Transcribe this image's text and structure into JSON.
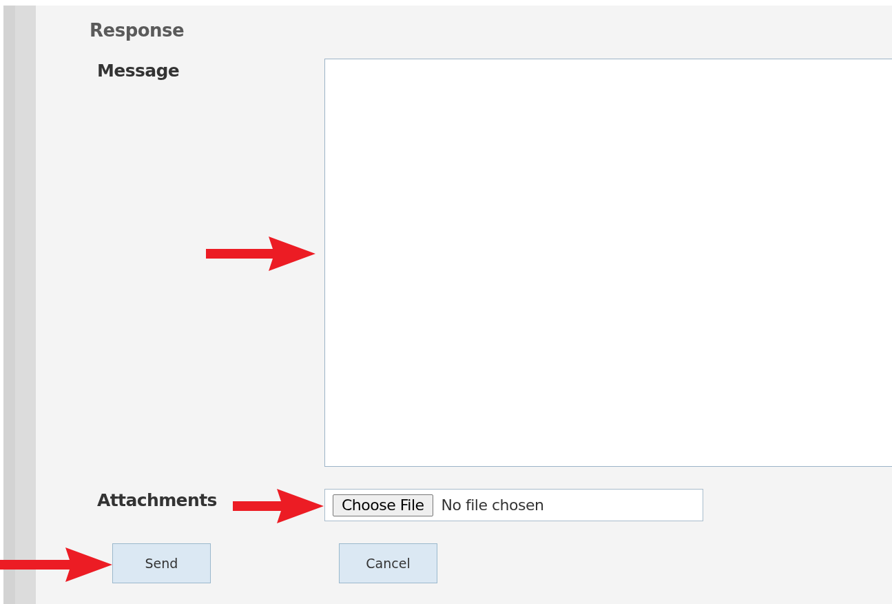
{
  "section_title": "Response",
  "message": {
    "label": "Message"
  },
  "attachments": {
    "label": "Attachments",
    "button": "Choose File",
    "status": "No file chosen"
  },
  "buttons": [
    {
      "label": "Send"
    },
    {
      "label": "Cancel"
    }
  ]
}
